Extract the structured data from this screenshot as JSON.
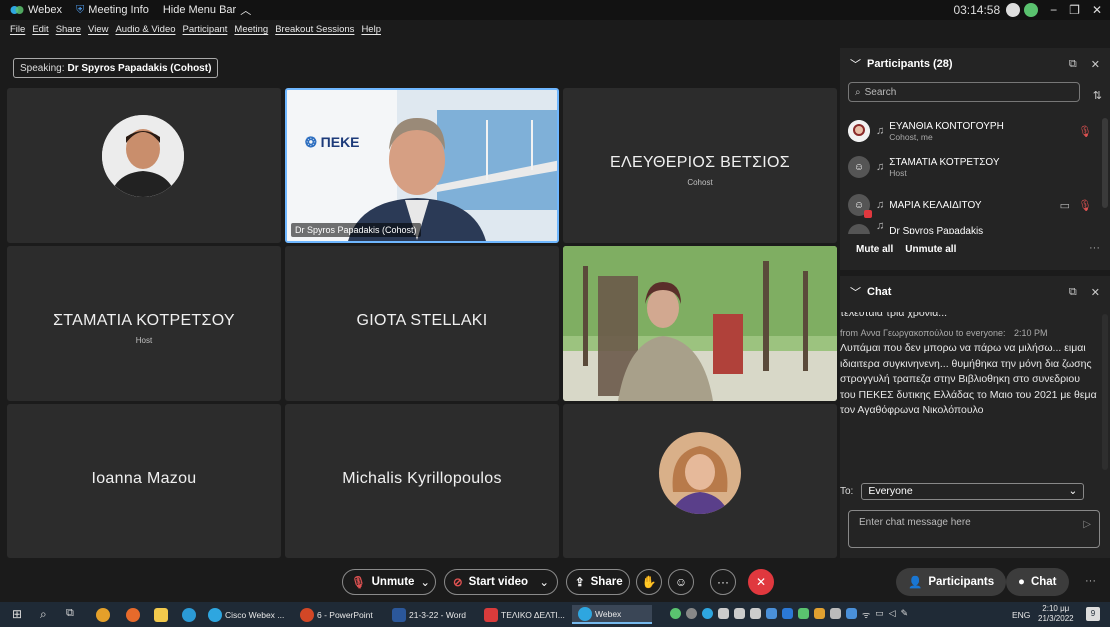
{
  "titlebar": {
    "app_name": "Webex",
    "meeting_info": "Meeting Info",
    "hide_menu": "Hide Menu Bar",
    "time": "03:14:58"
  },
  "menu": [
    "File",
    "Edit",
    "Share",
    "View",
    "Audio & Video",
    "Participant",
    "Meeting",
    "Breakout Sessions",
    "Help"
  ],
  "speaking": {
    "label": "Speaking:",
    "name": "Dr Spyros Papadakis (Cohost)"
  },
  "tiles": {
    "t2_chip": "Dr Spyros Papadakis (Cohost)",
    "t3_name": "ΕΛΕΥΘΕΡΙΟΣ ΒΕΤΣΙΟΣ",
    "t3_role": "Cohost",
    "t4_name": "ΣΤΑΜΑΤΙΑ ΚΟΤΡΕΤΣΟΥ",
    "t4_role": "Host",
    "t5_name": "GIOTA STELLAKI",
    "t7_name": "Ioanna Mazou",
    "t8_name": "Michalis Kyrillopoulos",
    "logo_text": "ΠΕΚΕ"
  },
  "participants": {
    "title": "Participants (28)",
    "search_placeholder": "Search",
    "rows": [
      {
        "name": "ΕΥΑΝΘΙΑ ΚΟΝΤΟΓΟΥΡΗ",
        "role": "Cohost, me"
      },
      {
        "name": "ΣΤΑΜΑΤΙΑ ΚΟΤΡΕΤΣΟΥ",
        "role": "Host"
      },
      {
        "name": "ΜΑΡΙΑ ΚΕΛΑΙΔΙΤΟΥ",
        "role": ""
      },
      {
        "name": "Dr Spyros Papadakis",
        "role": ""
      }
    ],
    "mute_all": "Mute all",
    "unmute_all": "Unmute all"
  },
  "chat": {
    "title": "Chat",
    "prev_line": "τελευταια τρια χρονια...",
    "from": "from Αννα Γεωργακοπούλου to everyone:",
    "from_time": "2:10 PM",
    "message": "Λυπάμαι που δεν μπορω να πάρω να μιλήσω... ειμαι ιδιαιτερα συγκινηνενη... θυμήθηκα την μόνη δια ζωσης στρογγυλή τραπεζα στην Βιβλιοθηκη στο συνεδριου του ΠΕΚΕΣ δυτικης Ελλάδας το Μαιο του 2021 με θεμα τον Αγαθόφρωνα Νικολόπουλο",
    "to_label": "To:",
    "to_value": "Everyone",
    "input_placeholder": "Enter chat message here"
  },
  "controls": {
    "unmute": "Unmute",
    "start_video": "Start video",
    "share": "Share",
    "participants": "Participants",
    "chat": "Chat"
  },
  "taskbar": {
    "items": [
      "Cisco Webex ...",
      "6 - PowerPoint",
      "21-3-22 - Word",
      "ΤΕΛΙΚΟ ΔΕΛΤΙ...",
      "Webex"
    ],
    "lang": "ENG",
    "time": "2:10 μμ",
    "date": "21/3/2022",
    "notif": "9"
  },
  "colors": {
    "accent": "#4a90d9",
    "end_red": "#e0383e",
    "mute_red": "#e05252"
  }
}
